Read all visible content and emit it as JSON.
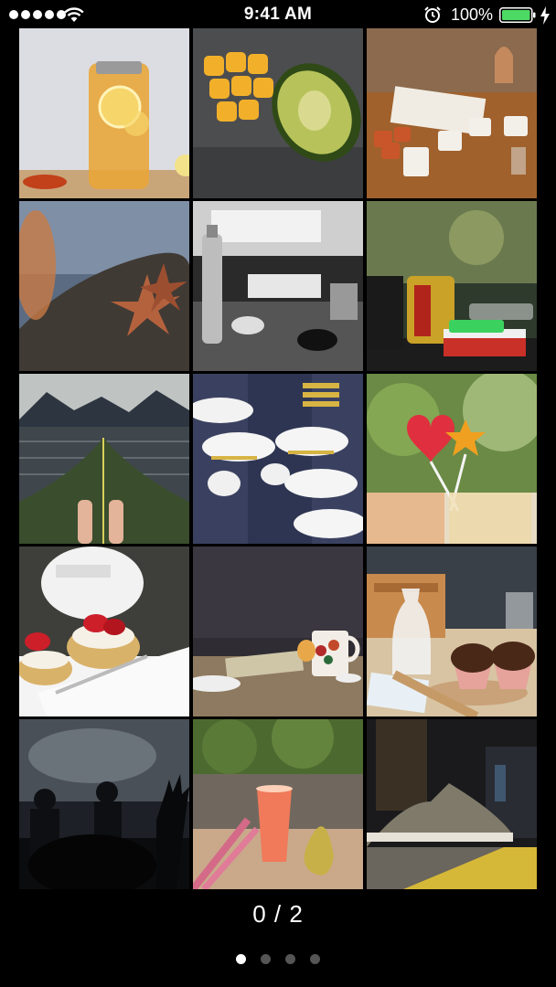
{
  "status_bar": {
    "time": "9:41 AM",
    "battery_percent": "100%",
    "signal_bars": 5,
    "battery_level": 1.0,
    "battery_color": "#4cd964",
    "icons": [
      "signal-dots",
      "wifi-icon",
      "alarm-icon",
      "battery-icon",
      "charging-bolt-icon"
    ]
  },
  "grid": {
    "photos": [
      {
        "name": "lemonade-jar-photo"
      },
      {
        "name": "mango-avocado-photo"
      },
      {
        "name": "coffee-cups-table-photo"
      },
      {
        "name": "starfish-rock-photo"
      },
      {
        "name": "workshop-bottle-photo"
      },
      {
        "name": "soda-can-lighter-photo"
      },
      {
        "name": "kayak-lake-photo"
      },
      {
        "name": "military-cadets-photo"
      },
      {
        "name": "heart-star-lollipop-photo"
      },
      {
        "name": "strawberry-scones-photo"
      },
      {
        "name": "mug-on-table-photo"
      },
      {
        "name": "chocolate-cupcakes-photo"
      },
      {
        "name": "concert-crowd-photo"
      },
      {
        "name": "juice-pear-photo"
      },
      {
        "name": "sneaker-curb-photo"
      }
    ]
  },
  "pager": {
    "counter_text": "0 / 2",
    "page_count": 4,
    "active_page": 1
  }
}
